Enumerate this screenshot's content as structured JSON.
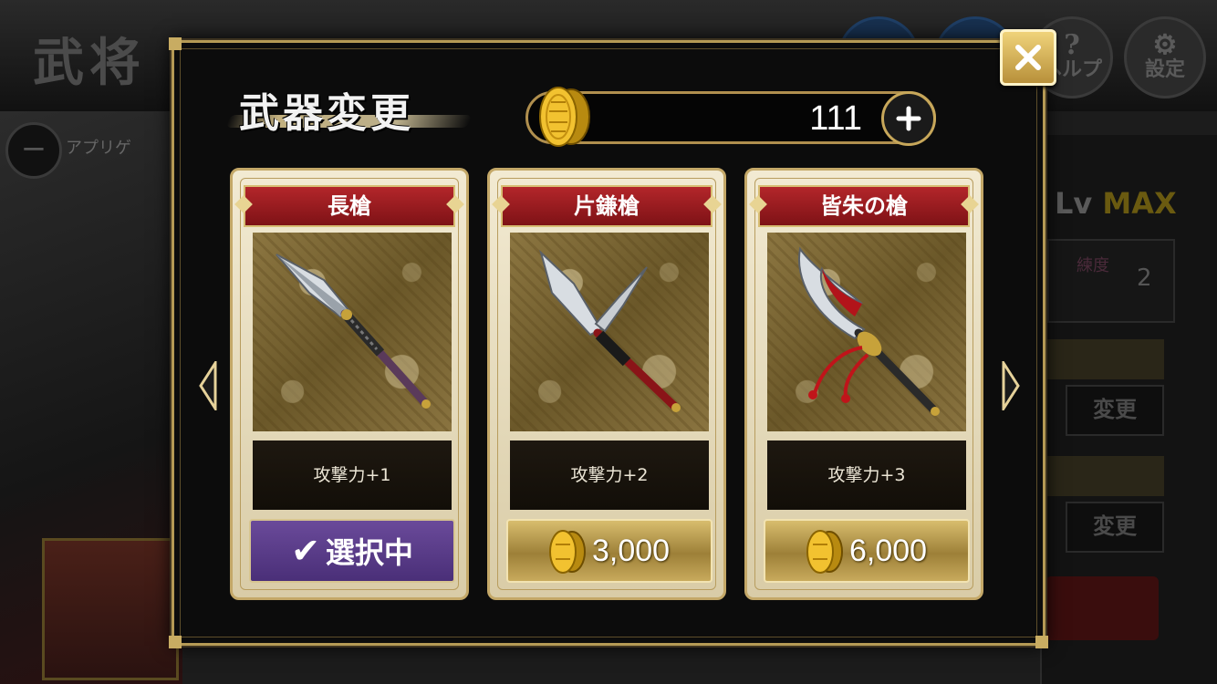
{
  "background": {
    "title": "武将",
    "help_label": "ヘルプ",
    "settings_label": "設定",
    "apply_label": "アプリゲ",
    "level_prefix": "Lv",
    "level_value": "MAX",
    "skill_kanji": "練度",
    "skill_value": "2",
    "change_label_1": "変更",
    "change_label_2": "変更"
  },
  "modal": {
    "title": "武器変更",
    "gold_amount": "111",
    "weapons": [
      {
        "name": "長槍",
        "stat": "攻撃力+1",
        "state": "selected",
        "button_label": "選択中"
      },
      {
        "name": "片鎌槍",
        "stat": "攻撃力+2",
        "state": "buy",
        "price": "3,000"
      },
      {
        "name": "皆朱の槍",
        "stat": "攻撃力+3",
        "state": "buy",
        "price": "6,000"
      }
    ]
  },
  "colors": {
    "frame_gold": "#b59a55",
    "header_red": "#9a1c20",
    "selected_purple": "#5a3c88"
  }
}
